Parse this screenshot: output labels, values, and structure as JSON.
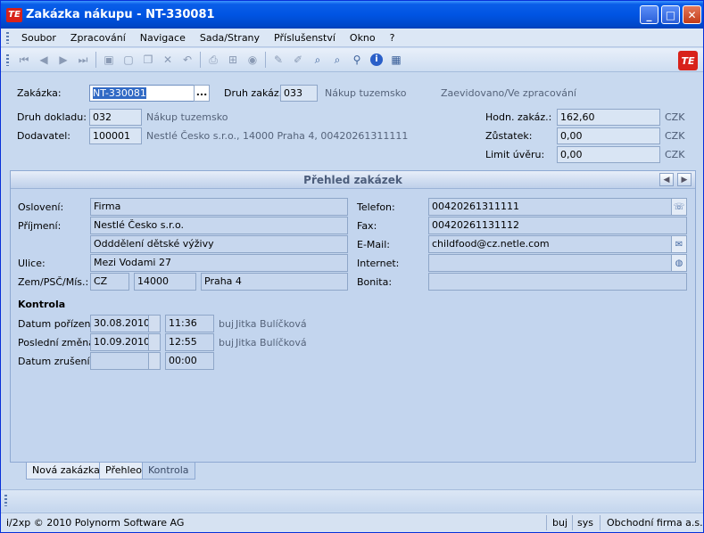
{
  "window": {
    "title": "Zakázka nákupu - NT-330081",
    "logo_text": "TE",
    "controls": [
      "_",
      "□",
      "✕"
    ]
  },
  "menu": [
    "Soubor",
    "Zpracování",
    "Navigace",
    "Sada/Strany",
    "Příslušenství",
    "Okno",
    "?"
  ],
  "toolbar": {
    "icons": [
      "first-icon",
      "prev-icon",
      "next-icon",
      "last-icon",
      "save-icon",
      "new-icon",
      "copy-icon",
      "delete-icon",
      "undo-icon",
      "print-icon",
      "tree-icon",
      "refresh-icon",
      "edit-icon",
      "edit2-icon",
      "search-list-icon",
      "search-icon",
      "zoom-icon",
      "info-icon",
      "grid-icon"
    ]
  },
  "header": {
    "zakazka_label": "Zakázka:",
    "zakazka_value": "NT-330081",
    "lookup_btn": "...",
    "druh_zakazky_label": "Druh zakáz.:",
    "druh_zakazky_value": "033",
    "druh_zakazky_text": "Nákup tuzemsko",
    "status_text": "Zaevidovano/Ve zpracování",
    "druh_dokladu_label": "Druh dokladu:",
    "druh_dokladu_value": "032",
    "druh_dokladu_text": "Nákup tuzemsko",
    "dodavatel_label": "Dodavatel:",
    "dodavatel_value": "100001",
    "dodavatel_text": "Nestlé Česko s.r.o., 14000 Praha 4, 00420261311111",
    "hodn_label": "Hodn. zakáz.:",
    "hodn_value": "162,60",
    "zustatek_label": "Zůstatek:",
    "zustatek_value": "0,00",
    "limit_label": "Limit úvěru:",
    "limit_value": "0,00",
    "currency": "CZK"
  },
  "panel": {
    "title": "Přehled zakázek",
    "osloveni_label": "Oslovení:",
    "osloveni_value": "Firma",
    "prijmeni_label": "Příjmení:",
    "prijmeni_value": "Nestlé Česko s.r.o.",
    "prijmeni2_value": "Odddělení dětské výživy",
    "ulice_label": "Ulice:",
    "ulice_value": "Mezi Vodami 27",
    "zem_label": "Zem/PSČ/Mís.:",
    "zem_value": "CZ",
    "psc_value": "14000",
    "misto_value": "Praha 4",
    "telefon_label": "Telefon:",
    "telefon_value": "00420261311111",
    "fax_label": "Fax:",
    "fax_value": "00420261131112",
    "email_label": "E-Mail:",
    "email_value": "childfood@cz.netle.com",
    "internet_label": "Internet:",
    "internet_value": "",
    "bonita_label": "Bonita:",
    "bonita_value": "",
    "kontrola_title": "Kontrola",
    "datum_porizeni_label": "Datum pořízení:",
    "datum_porizeni_value": "30.08.2010",
    "datum_porizeni_time": "11:36",
    "datum_porizeni_user": "buj",
    "datum_porizeni_name": "Jitka Bulíčková",
    "posledni_zmena_label": "Poslední změna:",
    "posledni_zmena_value": "10.09.2010",
    "posledni_zmena_time": "12:55",
    "posledni_zmena_user": "buj",
    "posledni_zmena_name": "Jitka Bulíčková",
    "datum_zruseni_label": "Datum zrušení:",
    "datum_zruseni_value": "",
    "datum_zruseni_time": "00:00"
  },
  "tabs": [
    "Nová zakázka",
    "Přehleo",
    "Kontrola"
  ],
  "status": {
    "copyright": "i/2xp © 2010 Polynorm Software AG",
    "user": "buj",
    "db": "sys",
    "company": "Obchodní firma a.s."
  }
}
